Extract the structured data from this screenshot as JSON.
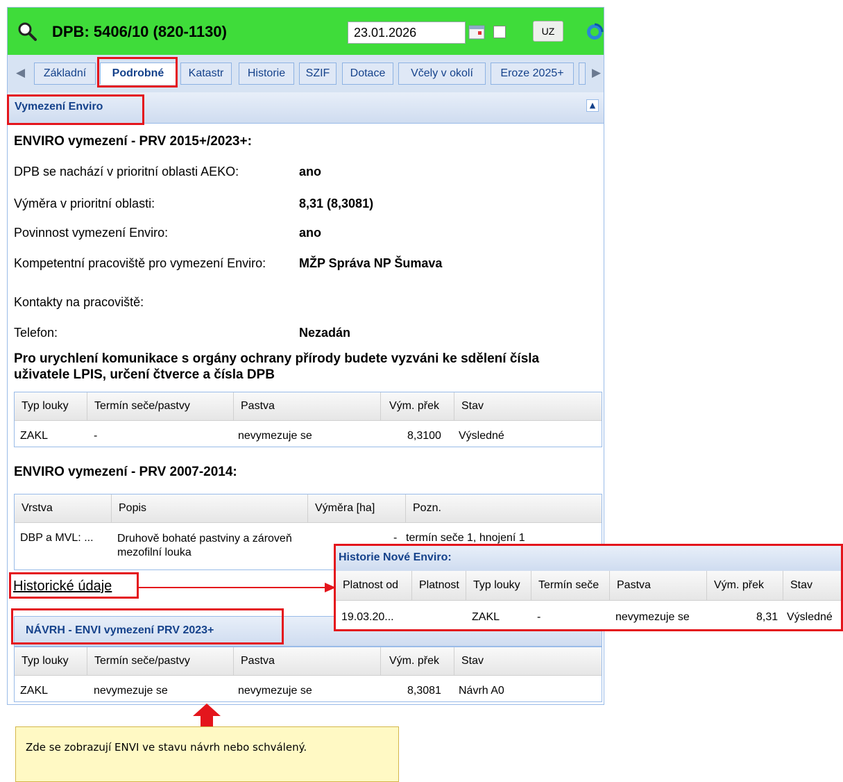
{
  "header": {
    "title": "DPB: 5406/10 (820-1130)",
    "date_value": "23.01.2026",
    "uz_button_label": "UZ",
    "bg_color": "#3fdc3a"
  },
  "tabs": [
    {
      "label": "Základní"
    },
    {
      "label": "Podrobné",
      "active": true
    },
    {
      "label": "Katastr"
    },
    {
      "label": "Historie"
    },
    {
      "label": "SZIF"
    },
    {
      "label": "Dotace"
    },
    {
      "label": "Včely v okolí"
    },
    {
      "label": "Eroze 2025+"
    }
  ],
  "section": {
    "title": "Vymezení Enviro"
  },
  "enviro_new": {
    "heading": "ENVIRO vymezení - PRV 2015+/2023+:",
    "rows": [
      {
        "label": "DPB se nachází v prioritní oblasti AEKO:",
        "value": "ano"
      },
      {
        "label": "Výměra v prioritní oblasti:",
        "value": "8,31 (8,3081)"
      },
      {
        "label": "Povinnost vymezení Enviro:",
        "value": "ano"
      },
      {
        "label": "Kompetentní pracoviště pro vymezení Enviro:",
        "value": "MŽP Správa NP Šumava"
      },
      {
        "label": "Kontakty na pracoviště:",
        "value": ""
      },
      {
        "label": "Telefon:",
        "value": "Nezadán"
      }
    ],
    "notice": "Pro urychlení komunikace s orgány ochrany přírody budete vyzváni ke sdělení čísla uživatele LPIS, určení čtverce a čísla DPB",
    "table": {
      "columns": [
        "Typ louky",
        "Termín seče/pastvy",
        "Pastva",
        "Vým. přek",
        "Stav"
      ],
      "rows": [
        [
          "ZAKL",
          "-",
          "nevymezuje se",
          "8,3100",
          "Výsledné"
        ]
      ]
    }
  },
  "enviro_old": {
    "heading": "ENVIRO vymezení - PRV 2007-2014:",
    "table": {
      "columns": [
        "Vrstva",
        "Popis",
        "Výměra [ha]",
        "Pozn."
      ],
      "rows": [
        [
          "DBP a MVL: ...",
          "Druhově bohaté pastviny a zároveň mezofilní louka",
          "-",
          "termín seče 1, hnojení 1"
        ]
      ]
    }
  },
  "history_link": "Historické údaje",
  "proposal": {
    "title": "NÁVRH - ENVI vymezení PRV 2023+",
    "table": {
      "columns": [
        "Typ louky",
        "Termín seče/pastvy",
        "Pastva",
        "Vým. přek",
        "Stav"
      ],
      "rows": [
        [
          "ZAKL",
          "nevymezuje se",
          "nevymezuje se",
          "8,3081",
          "Návrh A0"
        ]
      ]
    }
  },
  "history_popup": {
    "title": "Historie Nové Enviro:",
    "columns": [
      "Platnost od",
      "Platnost",
      "Typ louky",
      "Termín seče",
      "Pastva",
      "Vým. přek",
      "Stav"
    ],
    "rows": [
      [
        "19.03.20...",
        "",
        "ZAKL",
        "-",
        "nevymezuje se",
        "8,31",
        "Výsledné"
      ]
    ]
  },
  "note": "Zde se zobrazují ENVI ve stavu návrh nebo schválený.",
  "colors": {
    "highlight": "#e4151c",
    "note_bg": "#fff9c4",
    "accent_blue": "#15428b"
  }
}
